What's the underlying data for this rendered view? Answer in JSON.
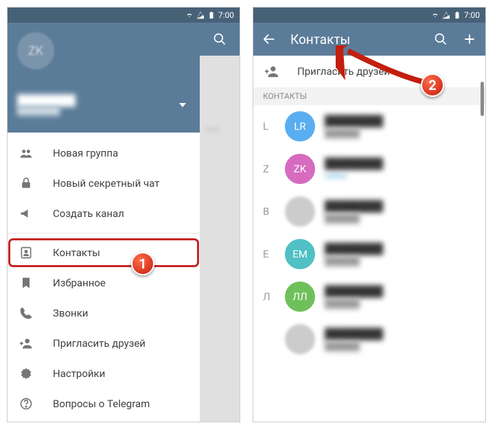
{
  "statusbar": {
    "time": "7:00"
  },
  "screen1": {
    "user": {
      "initials": "ZK",
      "name": "████████",
      "phone": "████████"
    },
    "search_icon": "search",
    "menu": [
      {
        "icon": "group-icon",
        "label": "Новая группа"
      },
      {
        "icon": "lock-icon",
        "label": "Новый секретный чат"
      },
      {
        "icon": "megaphone-icon",
        "label": "Создать канал"
      },
      {
        "divider": true
      },
      {
        "icon": "contacts-icon",
        "label": "Контакты",
        "highlight": true
      },
      {
        "icon": "bookmark-icon",
        "label": "Избранное"
      },
      {
        "icon": "phone-icon",
        "label": "Звонки"
      },
      {
        "icon": "add-person-icon",
        "label": "Пригласить друзей"
      },
      {
        "icon": "gear-icon",
        "label": "Настройки"
      },
      {
        "icon": "help-icon",
        "label": "Вопросы о Telegram"
      }
    ],
    "bg_text": "om"
  },
  "screen2": {
    "back_icon": "back",
    "title": "Контакты",
    "search_icon": "search",
    "add_icon": "add",
    "invite": {
      "icon": "add-person-icon",
      "label": "Пригласить друзей"
    },
    "section": "КОНТАКТЫ",
    "contacts": [
      {
        "letter": "L",
        "avatar_bg": "#5aaef0",
        "avatar_text": "LR",
        "name": "████████",
        "sub": "██████"
      },
      {
        "letter": "Z",
        "avatar_bg": "#d66bbf",
        "avatar_text": "ZK",
        "name": "████████",
        "sub": "online",
        "online": true
      },
      {
        "letter": "B",
        "avatar_img": true,
        "name": "████████",
        "sub": "██████"
      },
      {
        "letter": "E",
        "avatar_bg": "#4fc0c4",
        "avatar_text": "ЕМ",
        "name": "████████",
        "sub": "██████"
      },
      {
        "letter": "Л",
        "avatar_bg": "#6fc05a",
        "avatar_text": "ЛЛ",
        "name": "████████",
        "sub": "██████"
      },
      {
        "letter": "",
        "avatar_img": true,
        "name": "████████",
        "sub": "██████"
      }
    ]
  },
  "callouts": {
    "one": "1",
    "two": "2"
  }
}
